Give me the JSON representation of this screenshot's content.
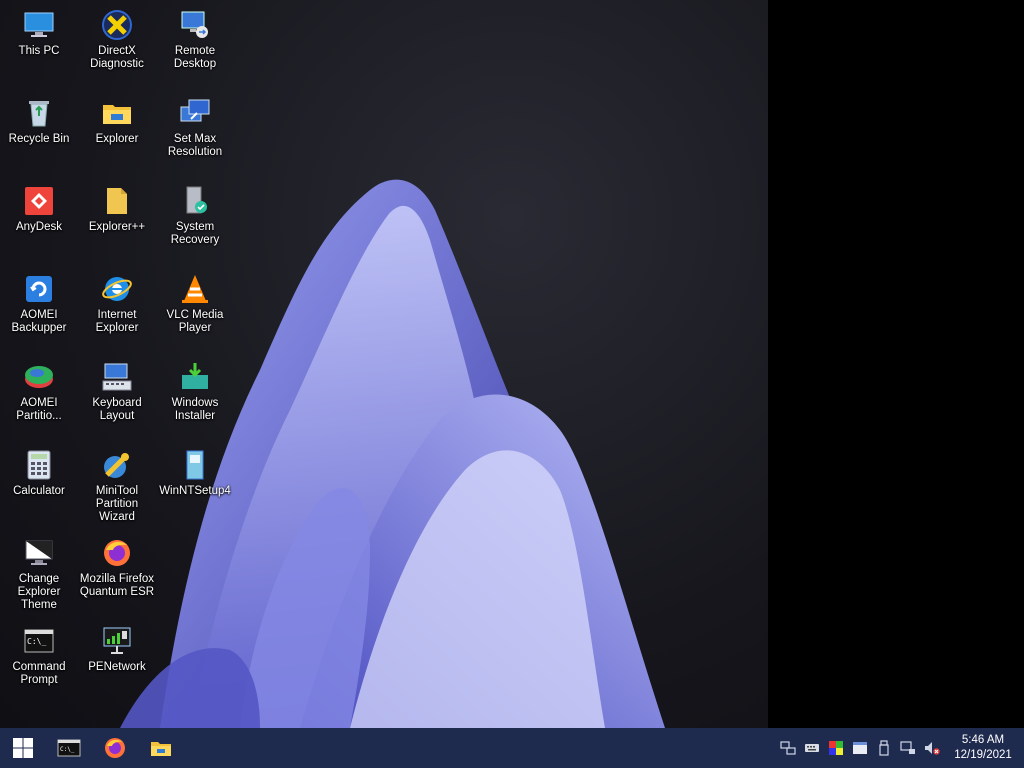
{
  "desktop_icons": [
    {
      "label": "This PC",
      "icon": "computer-icon"
    },
    {
      "label": "DirectX Diagnostic",
      "icon": "directx-icon"
    },
    {
      "label": "Remote Desktop",
      "icon": "remote-desktop-icon"
    },
    {
      "label": "Recycle Bin",
      "icon": "recycle-bin-icon"
    },
    {
      "label": "Explorer",
      "icon": "folder-icon"
    },
    {
      "label": "Set Max Resolution",
      "icon": "display-settings-icon"
    },
    {
      "label": "AnyDesk",
      "icon": "anydesk-icon"
    },
    {
      "label": "Explorer++",
      "icon": "folder-plus-icon"
    },
    {
      "label": "System Recovery",
      "icon": "system-recovery-icon"
    },
    {
      "label": "AOMEI Backupper",
      "icon": "aomei-backupper-icon"
    },
    {
      "label": "Internet Explorer",
      "icon": "internet-explorer-icon"
    },
    {
      "label": "VLC Media Player",
      "icon": "vlc-icon"
    },
    {
      "label": "AOMEI Partitio...",
      "icon": "aomei-partition-icon"
    },
    {
      "label": "Keyboard Layout",
      "icon": "keyboard-layout-icon"
    },
    {
      "label": "Windows Installer",
      "icon": "windows-installer-icon"
    },
    {
      "label": "Calculator",
      "icon": "calculator-icon"
    },
    {
      "label": "MiniTool Partition Wizard",
      "icon": "minitool-icon"
    },
    {
      "label": "WinNTSetup4",
      "icon": "winntsetup-icon"
    },
    {
      "label": "Change Explorer Theme",
      "icon": "theme-monitor-icon"
    },
    {
      "label": "Mozilla Firefox Quantum ESR",
      "icon": "firefox-icon"
    },
    {
      "label": "Command Prompt",
      "icon": "command-prompt-icon"
    },
    {
      "label": "PENetwork",
      "icon": "network-icon"
    }
  ],
  "taskbar": {
    "pinned": [
      {
        "name": "start-button",
        "icon": "windows-logo-icon"
      },
      {
        "name": "taskbar-command-prompt",
        "icon": "command-prompt-icon"
      },
      {
        "name": "taskbar-firefox",
        "icon": "firefox-icon"
      },
      {
        "name": "taskbar-explorer",
        "icon": "folder-icon"
      }
    ],
    "tray": [
      {
        "name": "tray-network-share",
        "icon": "network-share-icon"
      },
      {
        "name": "tray-keyboard",
        "icon": "keyboard-icon"
      },
      {
        "name": "tray-color",
        "icon": "color-icon"
      },
      {
        "name": "tray-window",
        "icon": "window-icon"
      },
      {
        "name": "tray-usb",
        "icon": "usb-icon"
      },
      {
        "name": "tray-network",
        "icon": "network-icon"
      },
      {
        "name": "tray-volume-muted",
        "icon": "volume-muted-icon"
      }
    ],
    "time": "5:46 AM",
    "date": "12/19/2021"
  },
  "colors": {
    "taskbar": "#1f2a4f",
    "wallpaper_bloom": "#6b6fd6"
  }
}
